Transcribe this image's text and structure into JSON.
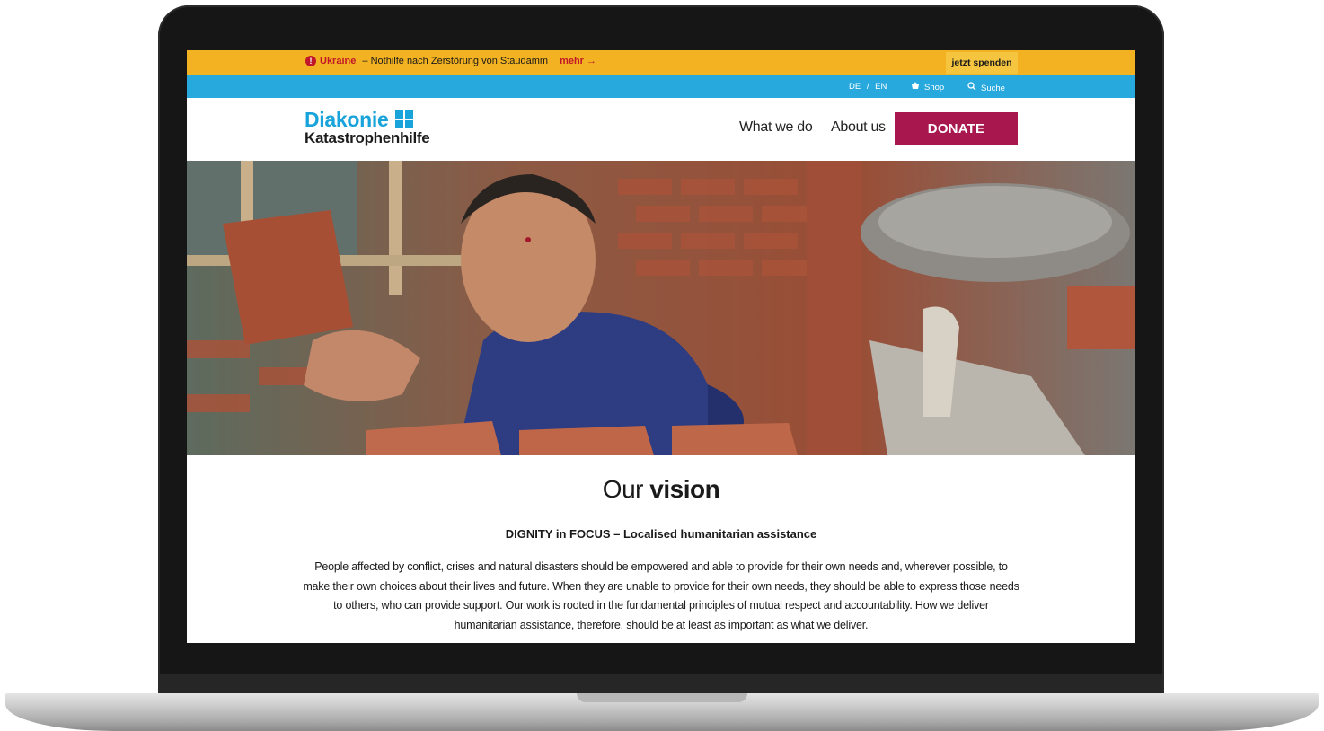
{
  "alert": {
    "icon": "exclamation-circle-icon",
    "highlight": "Ukraine",
    "message": " – Nothilfe nach Zerstörung von Staudamm | ",
    "more": "mehr →",
    "donate_now": "jetzt spenden"
  },
  "utility": {
    "lang_de": "DE",
    "lang_sep": "/",
    "lang_en": "EN",
    "shop": "Shop",
    "search": "Suche"
  },
  "nav": {
    "logo_top": "Diakonie",
    "logo_bottom": "Katastrophenhilfe",
    "what_we_do": "What we do",
    "about_us": "About us",
    "donate": "DONATE"
  },
  "vision": {
    "title_light": "Our ",
    "title_bold": "vision",
    "subtitle": "DIGNITY in FOCUS – Localised humanitarian assistance",
    "body": "People affected by conflict, crises and natural disasters should be empowered and able to provide for their own needs and, wherever possible, to make their own choices about their lives and future. When they are unable to provide for their own needs, they should be able to express those needs to others, who can provide support. Our work is rooted in the fundamental principles of mutual respect and accountability. How we deliver humanitarian assistance, therefore, should be at least as important as what we deliver."
  },
  "colors": {
    "alert_bg": "#f3b221",
    "util_bg": "#27a9de",
    "brand_blue": "#19a3db",
    "donate_bg": "#a8174e",
    "alert_red": "#c0172a"
  }
}
